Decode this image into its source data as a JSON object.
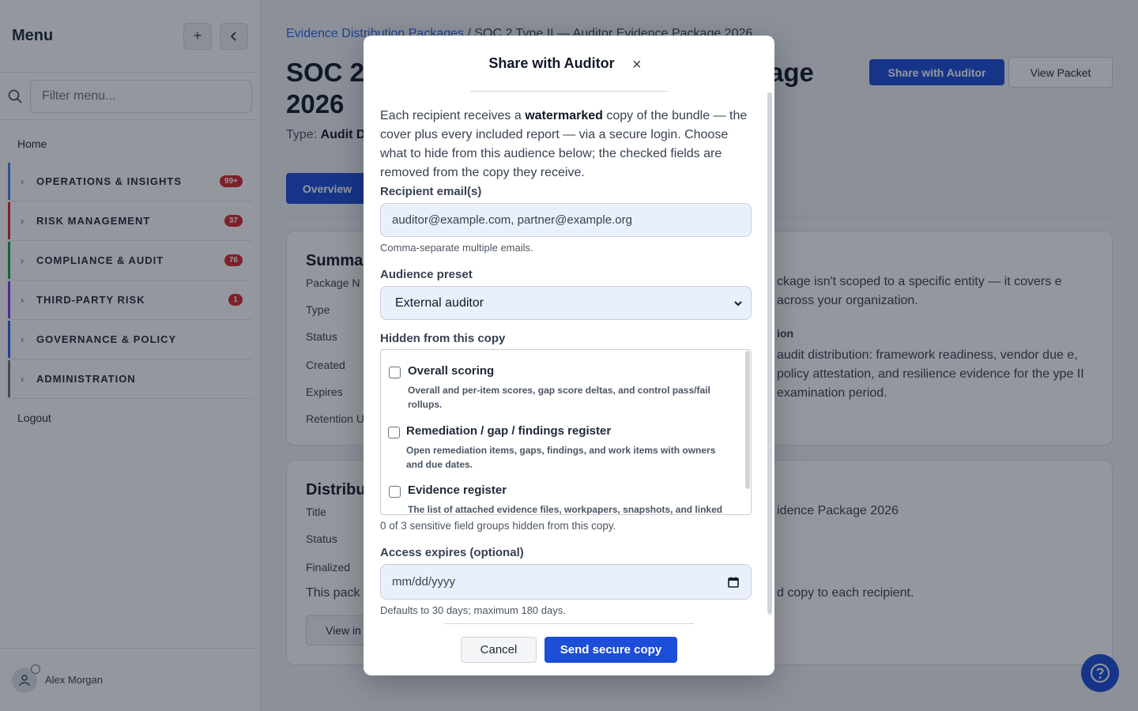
{
  "sidebar": {
    "title": "Menu",
    "filter_placeholder": "Filter menu...",
    "home": "Home",
    "sections": [
      {
        "label": "OPERATIONS & INSIGHTS",
        "badge": "99+",
        "color": "#3b82f6"
      },
      {
        "label": "RISK MANAGEMENT",
        "badge": "37",
        "color": "#dc2626"
      },
      {
        "label": "COMPLIANCE & AUDIT",
        "badge": "76",
        "color": "#16a34a"
      },
      {
        "label": "THIRD-PARTY RISK",
        "badge": "1",
        "color": "#7c3aed"
      },
      {
        "label": "GOVERNANCE & POLICY",
        "badge": "",
        "color": "#2563eb"
      },
      {
        "label": "ADMINISTRATION",
        "badge": "",
        "color": "#6b7280"
      }
    ],
    "logout": "Logout",
    "user_name": "Alex Morgan"
  },
  "main": {
    "breadcrumb_link": "Evidence Distribution Packages",
    "breadcrumb_sep": " / ",
    "breadcrumb_current": "SOC 2 Type II — Auditor Evidence Package 2026",
    "title_start": "SOC 2",
    "title_end": "age",
    "title_line2": "2026",
    "type_label": "Type:",
    "type_value": "Audit D",
    "share_button": "Share with Auditor",
    "view_packet_button": "View Packet",
    "tab_overview": "Overview",
    "summary": {
      "heading": "Summar",
      "fields": [
        "Package N",
        "Type",
        "Status",
        "Created",
        "Expires",
        "Retention U"
      ],
      "scope_text": "ckage isn't scoped to a specific entity — it covers e across your organization.",
      "section_label": "ion",
      "desc_text": "audit distribution: framework readiness, vendor due e, policy attestation, and resilience evidence for the ype II examination period."
    },
    "distribution": {
      "heading": "Distribu",
      "fields": [
        "Title",
        "Status",
        "Finalized"
      ],
      "title_value": "idence Package 2026",
      "note_start": "This pack",
      "note_end": "d copy to each recipient.",
      "view_button": "View in"
    }
  },
  "modal": {
    "title": "Share with Auditor",
    "close_glyph": "×",
    "intro_pre": "Each recipient receives a ",
    "intro_bold": "watermarked",
    "intro_post": " copy of the bundle — the cover plus every included report — via a secure login. Choose what to hide from this audience below; the checked fields are removed from the copy they receive.",
    "recipients_label": "Recipient email(s)",
    "recipients_placeholder": "auditor@example.com, partner@example.org",
    "recipients_hint": "Comma-separate multiple emails.",
    "audience_label": "Audience preset",
    "audience_value": "External auditor",
    "hidden_label": "Hidden from this copy",
    "hidden_items": [
      {
        "title": "Overall scoring",
        "desc": "Overall and per-item scores, gap score deltas, and control pass/fail rollups."
      },
      {
        "title": "Remediation / gap / findings register",
        "desc": "Open remediation items, gaps, findings, and work items with owners and due dates."
      },
      {
        "title": "Evidence register",
        "desc": "The list of attached evidence files, workpapers, snapshots, and linked"
      }
    ],
    "hidden_count": "0 of 3 sensitive field groups hidden from this copy.",
    "expires_label": "Access expires (optional)",
    "expires_placeholder": "mm/dd/yyyy",
    "expires_hint": "Defaults to 30 days; maximum 180 days.",
    "cancel_button": "Cancel",
    "send_button": "Send secure copy"
  },
  "colors": {
    "primary": "#1d4ed8",
    "badge": "#d7262d"
  }
}
